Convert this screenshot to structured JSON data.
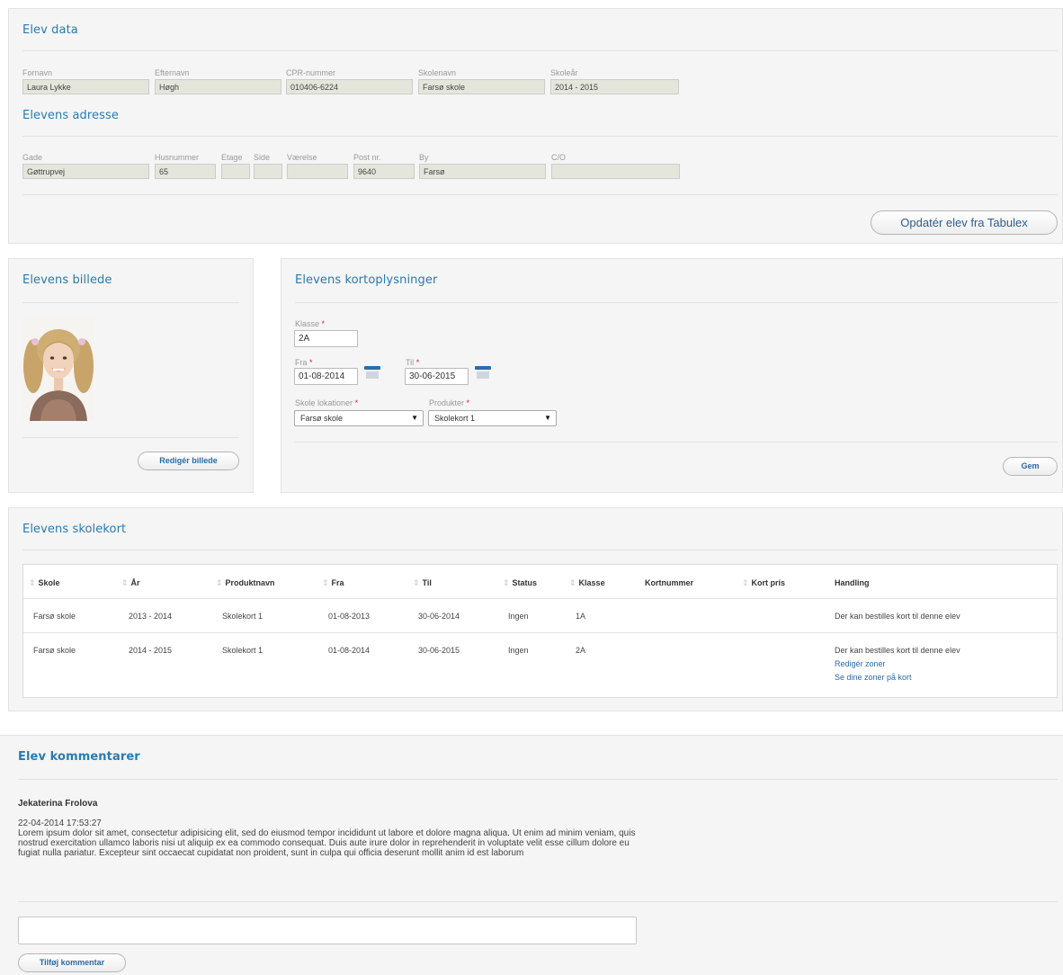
{
  "elev_data": {
    "title": "Elev data",
    "fields": [
      {
        "label": "Fornavn",
        "value": "Laura Lykke"
      },
      {
        "label": "Efternavn",
        "value": "Høgh"
      },
      {
        "label": "CPR-nummer",
        "value": "010406-6224"
      },
      {
        "label": "Skolenavn",
        "value": "Farsø skole"
      },
      {
        "label": "Skoleår",
        "value": "2014 - 2015"
      }
    ]
  },
  "adresse": {
    "title": "Elevens adresse",
    "fields": [
      {
        "label": "Gade",
        "value": "Gøttrupvej"
      },
      {
        "label": "Husnummer",
        "value": "65"
      },
      {
        "label": "Etage",
        "value": ""
      },
      {
        "label": "Side",
        "value": ""
      },
      {
        "label": "Værelse",
        "value": ""
      },
      {
        "label": "Post nr.",
        "value": "9640"
      },
      {
        "label": "By",
        "value": "Farsø"
      },
      {
        "label": "C/O",
        "value": ""
      }
    ],
    "update_button": "Opdatér elev fra Tabulex"
  },
  "billede": {
    "title": "Elevens billede",
    "edit_button": "Redigér billede"
  },
  "kortoplysninger": {
    "title": "Elevens kortoplysninger",
    "klasse": {
      "label": "Klasse",
      "value": "2A"
    },
    "fra": {
      "label": "Fra",
      "value": "01-08-2014"
    },
    "til": {
      "label": "Til",
      "value": "30-06-2015"
    },
    "lokation": {
      "label": "Skole lokationer",
      "value": "Farsø skole"
    },
    "produkter": {
      "label": "Produkter",
      "value": "Skolekort 1"
    },
    "required_mark": "*",
    "save_button": "Gem"
  },
  "skolekort": {
    "title": "Elevens skolekort",
    "columns": [
      "Skole",
      "År",
      "Produktnavn",
      "Fra",
      "Til",
      "Status",
      "Klasse",
      "Kortnummer",
      "Kort pris",
      "Handling"
    ],
    "rows": [
      {
        "skole": "Farsø skole",
        "aar": "2013 - 2014",
        "produkt": "Skolekort 1",
        "fra": "01-08-2013",
        "til": "30-06-2014",
        "status": "Ingen",
        "klasse": "1A",
        "kortnummer": "",
        "pris": "",
        "handling": "Der kan bestilles kort til denne elev",
        "links": []
      },
      {
        "skole": "Farsø skole",
        "aar": "2014 - 2015",
        "produkt": "Skolekort 1",
        "fra": "01-08-2014",
        "til": "30-06-2015",
        "status": "Ingen",
        "klasse": "2A",
        "kortnummer": "",
        "pris": "",
        "handling": "Der kan bestilles kort til denne elev",
        "links": [
          "Redigér zoner",
          "Se dine zoner på kort"
        ]
      }
    ]
  },
  "kommentarer": {
    "title": "Elev kommentarer",
    "comment": {
      "author": "Jekaterina Frolova",
      "date": "22-04-2014 17:53:27",
      "text": "Lorem ipsum dolor sit amet, consectetur adipisicing elit, sed do eiusmod tempor incididunt ut labore et dolore magna aliqua. Ut enim ad minim veniam, quis nostrud exercitation ullamco laboris nisi ut aliquip ex ea commodo consequat. Duis aute irure dolor in reprehenderit in voluptate velit esse cillum dolore eu fugiat nulla pariatur. Excepteur sint occaecat cupidatat non proident, sunt in culpa qui officia deserunt mollit anim id est laborum"
    },
    "add_button": "Tilføj kommentar"
  },
  "colors": {
    "accent": "#2a7ab0",
    "required": "#d9232a",
    "readonly_bg": "#e4e6dc"
  }
}
